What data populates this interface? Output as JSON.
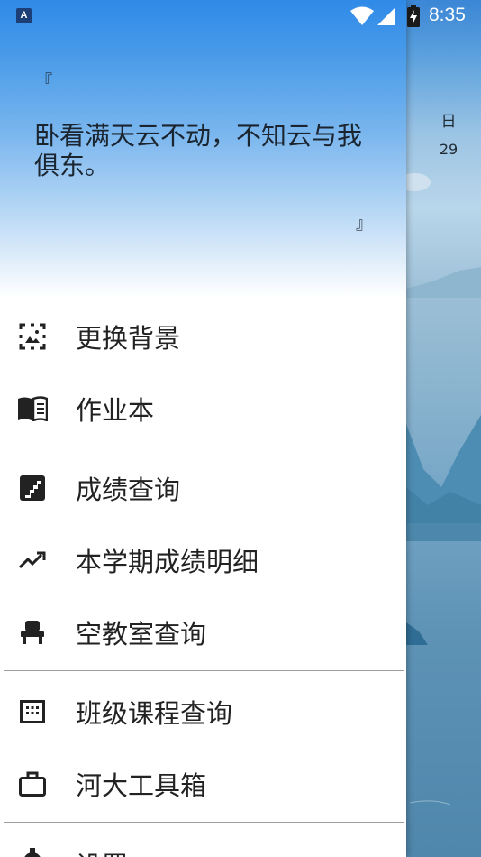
{
  "status_bar": {
    "app_icon_letter": "A",
    "time": "8:35"
  },
  "background_app": {
    "day_label": "日",
    "date_label": "29",
    "download_icon": "download-icon"
  },
  "drawer": {
    "quote_open": "『",
    "quote_text": "卧看满天云不动，不知云与我俱东。",
    "quote_close": "』",
    "menu": [
      {
        "label": "更换背景",
        "icon": "image-frame-icon"
      },
      {
        "label": "作业本",
        "icon": "book-open-icon"
      },
      {
        "label": "成绩查询",
        "icon": "stairs-icon"
      },
      {
        "label": "本学期成绩明细",
        "icon": "trending-up-icon"
      },
      {
        "label": "空教室查询",
        "icon": "seat-icon"
      },
      {
        "label": "班级课程查询",
        "icon": "calendar-grid-icon"
      },
      {
        "label": "河大工具箱",
        "icon": "briefcase-icon"
      },
      {
        "label": "设置",
        "icon": "gear-icon"
      }
    ]
  }
}
